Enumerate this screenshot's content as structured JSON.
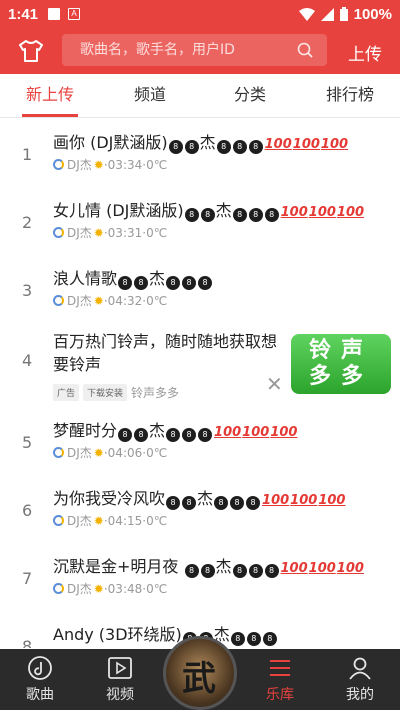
{
  "status": {
    "time": "1:41",
    "battery": "100%"
  },
  "header": {
    "search_placeholder": "歌曲名，歌手名，用户ID",
    "upload_label": "上传"
  },
  "tabs": [
    "新上传",
    "频道",
    "分类",
    "排行榜"
  ],
  "songs": [
    {
      "index": "1",
      "title": "画你 (DJ默涵版)",
      "suffix": [
        "8",
        "8",
        "杰",
        "8",
        "8",
        "8"
      ],
      "hundreds": 3,
      "artist": "DJ杰",
      "duration": "03:34",
      "temp": "0℃"
    },
    {
      "index": "2",
      "title": "女儿情 (DJ默涵版)",
      "suffix": [
        "8",
        "8",
        "杰",
        "8",
        "8",
        "8"
      ],
      "hundreds": 3,
      "artist": "DJ杰",
      "duration": "03:31",
      "temp": "0℃"
    },
    {
      "index": "3",
      "title": "浪人情歌",
      "suffix": [
        "8",
        "8",
        "杰",
        "8",
        "8",
        "8"
      ],
      "hundreds": 0,
      "artist": "DJ杰",
      "duration": "04:32",
      "temp": "0℃"
    },
    {
      "index": "5",
      "title": "梦醒时分",
      "suffix": [
        "8",
        "8",
        "杰",
        "8",
        "8",
        "8"
      ],
      "hundreds": 3,
      "artist": "DJ杰",
      "duration": "04:06",
      "temp": "0℃"
    },
    {
      "index": "6",
      "title": "为你我受冷风吹",
      "suffix": [
        "8",
        "8",
        "杰",
        "8",
        "8",
        "8"
      ],
      "hundreds": 3,
      "artist": "DJ杰",
      "duration": "04:15",
      "temp": "0℃"
    },
    {
      "index": "7",
      "title": "沉默是金+明月夜 ",
      "suffix": [
        "8",
        "8",
        "杰",
        "8",
        "8",
        "8"
      ],
      "hundreds": 3,
      "artist": "DJ杰",
      "duration": "03:48",
      "temp": "0℃"
    },
    {
      "index": "8",
      "title": "Andy (3D环绕版)",
      "suffix": [
        "8",
        "8",
        "杰",
        "8",
        "8",
        "8"
      ],
      "hundreds": 0,
      "artist": "",
      "duration": "",
      "temp": ""
    }
  ],
  "ad": {
    "index": "4",
    "title": "百万热门铃声，随时随地获取想要铃声",
    "tag_ad": "广告",
    "tag_install": "下载安装",
    "brand": "铃声多多",
    "logo_line1": "铃声",
    "logo_line2": "多多"
  },
  "nav": [
    {
      "label": "歌曲",
      "icon": "music-disc-icon"
    },
    {
      "label": "视频",
      "icon": "video-play-icon"
    },
    {
      "label": "",
      "icon": "center-disc"
    },
    {
      "label": "乐库",
      "icon": "library-menu-icon"
    },
    {
      "label": "我的",
      "icon": "person-icon"
    }
  ],
  "center_disc_char": "武"
}
